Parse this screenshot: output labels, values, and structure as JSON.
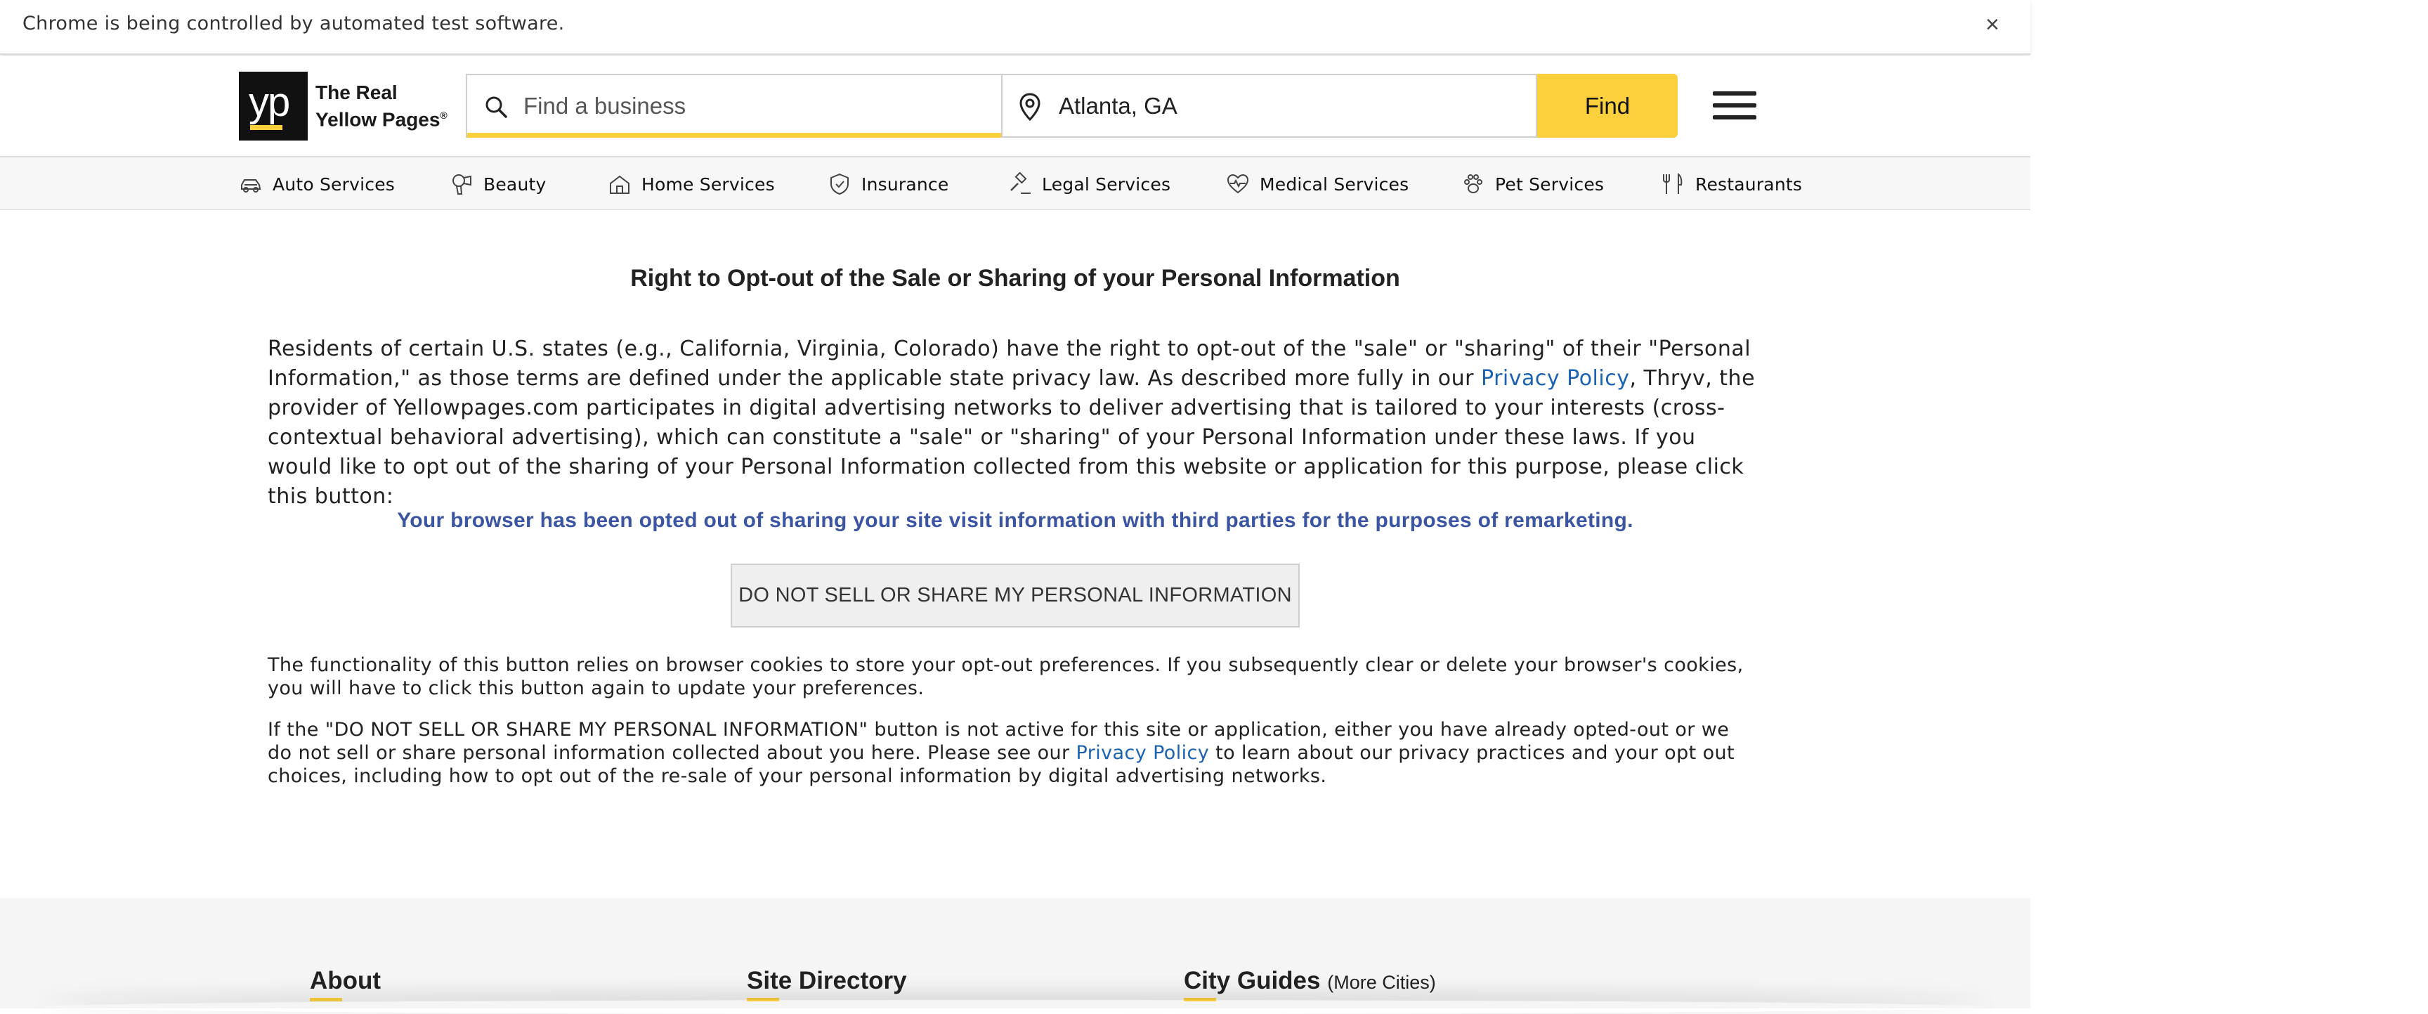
{
  "infobar": {
    "message": "Chrome is being controlled by automated test software.",
    "close_glyph": "×"
  },
  "header": {
    "logo": {
      "mark": "yp",
      "line1": "The Real",
      "line2": "Yellow Pages"
    },
    "search": {
      "what_placeholder": "Find a business",
      "where_value": "Atlanta, GA"
    },
    "find_label": "Find"
  },
  "categories": [
    {
      "label": "Auto Services",
      "icon": "car-icon"
    },
    {
      "label": "Beauty",
      "icon": "hair-dryer-icon"
    },
    {
      "label": "Home Services",
      "icon": "home-icon"
    },
    {
      "label": "Insurance",
      "icon": "shield-icon"
    },
    {
      "label": "Legal Services",
      "icon": "gavel-icon"
    },
    {
      "label": "Medical Services",
      "icon": "heart-pulse-icon"
    },
    {
      "label": "Pet Services",
      "icon": "paw-icon"
    },
    {
      "label": "Restaurants",
      "icon": "utensils-icon"
    }
  ],
  "main": {
    "title": "Right to Opt-out of the Sale or Sharing of your Personal Information",
    "para1_a": "Residents of certain U.S. states (e.g., California, Virginia, Colorado) have the right to opt-out of the \"sale\" or \"sharing\" of their \"Personal Information,\" as those terms are defined under the applicable state privacy law. As described more fully in our ",
    "para1_link": "Privacy Policy",
    "para1_b": ", Thryv, the provider of Yellowpages.com participates in digital advertising networks to deliver advertising that is tailored to your interests (cross-contextual behavioral advertising), which can constitute a \"sale\" or \"sharing\" of your Personal Information under these laws. If you would like to opt out of the sharing of your Personal Information collected from this website or application for this purpose, please click this button:",
    "opted_message": "Your browser has been opted out of sharing your site visit information with third parties for the purposes of remarketing.",
    "dns_button": "DO NOT SELL OR SHARE MY PERSONAL INFORMATION",
    "para2": "The functionality of this button relies on browser cookies to store your opt-out preferences. If you subsequently clear or delete your browser's cookies, you will have to click this button again to update your preferences.",
    "para3_a": "If the \"DO NOT SELL OR SHARE MY PERSONAL INFORMATION\" button is not active for this site or application, either you have already opted-out or we do not sell or share personal information collected about you here. Please see our ",
    "para3_link": "Privacy Policy",
    "para3_b": " to learn about our privacy practices and your opt out choices, including how to opt out of the re-sale of your personal information by digital advertising networks."
  },
  "footer": {
    "about": "About",
    "site_directory": "Site Directory",
    "city_guides": "City Guides",
    "more_cities": "(More Cities)"
  },
  "colors": {
    "brand_yellow": "#fbd03c",
    "link_blue": "#1b62b3",
    "opted_blue": "#3c55a3"
  }
}
